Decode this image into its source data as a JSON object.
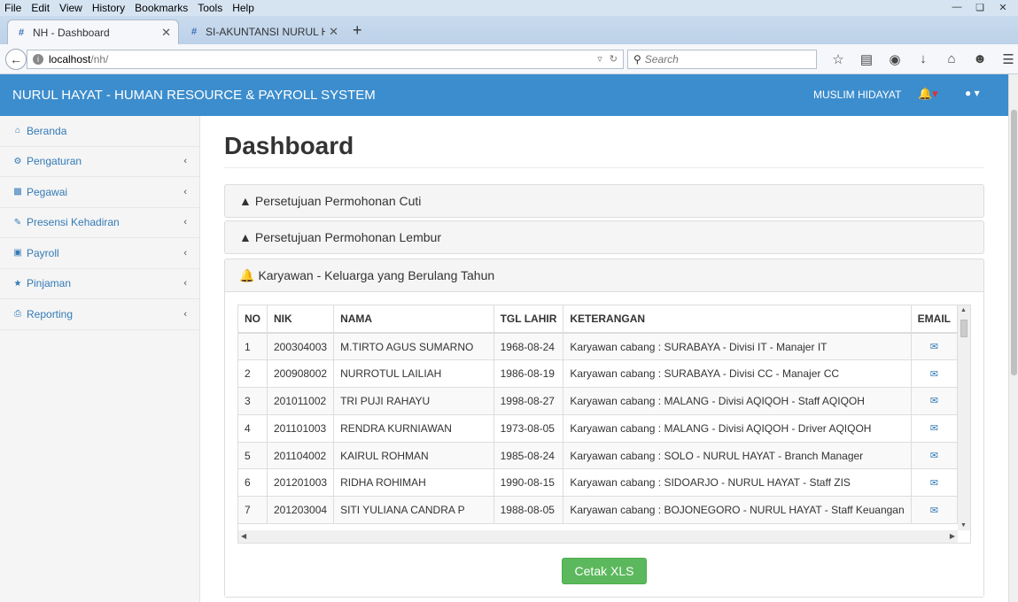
{
  "browser": {
    "menu": [
      "File",
      "Edit",
      "View",
      "History",
      "Bookmarks",
      "Tools",
      "Help"
    ],
    "tabs": [
      {
        "title": "NH - Dashboard",
        "active": true
      },
      {
        "title": "SI-AKUNTANSI NURUL HA...",
        "active": false
      }
    ],
    "url_host": "localhost",
    "url_path": "/nh/",
    "search_placeholder": "Search"
  },
  "header": {
    "brand": "NURUL HAYAT - HUMAN RESOURCE & PAYROLL SYSTEM",
    "user": "MUSLIM HIDAYAT"
  },
  "sidebar": {
    "items": [
      {
        "label": "Beranda",
        "icon": "home-icon"
      },
      {
        "label": "Pengaturan",
        "icon": "cogs-icon"
      },
      {
        "label": "Pegawai",
        "icon": "sitemap-icon"
      },
      {
        "label": "Presensi Kehadiran",
        "icon": "edit-icon"
      },
      {
        "label": "Payroll",
        "icon": "money-icon"
      },
      {
        "label": "Pinjaman",
        "icon": "star-icon"
      },
      {
        "label": "Reporting",
        "icon": "print-icon"
      }
    ]
  },
  "main": {
    "title": "Dashboard",
    "panels": [
      {
        "title": "Persetujuan Permohonan Cuti"
      },
      {
        "title": "Persetujuan Permohonan Lembur"
      },
      {
        "title": "Karyawan - Keluarga yang Berulang Tahun"
      }
    ],
    "table": {
      "columns": [
        "NO",
        "NIK",
        "NAMA",
        "TGL LAHIR",
        "KETERANGAN",
        "EMAIL"
      ],
      "rows": [
        [
          "1",
          "200304003",
          "M.TIRTO AGUS SUMARNO",
          "1968-08-24",
          "Karyawan cabang : SURABAYA - Divisi IT - Manajer IT"
        ],
        [
          "2",
          "200908002",
          "NURROTUL LAILIAH",
          "1986-08-19",
          "Karyawan cabang : SURABAYA - Divisi CC - Manajer CC"
        ],
        [
          "3",
          "201011002",
          "TRI PUJI RAHAYU",
          "1998-08-27",
          "Karyawan cabang : MALANG - Divisi AQIQOH - Staff AQIQOH"
        ],
        [
          "4",
          "201101003",
          "RENDRA KURNIAWAN",
          "1973-08-05",
          "Karyawan cabang : MALANG - Divisi AQIQOH - Driver AQIQOH"
        ],
        [
          "5",
          "201104002",
          "KAIRUL ROHMAN",
          "1985-08-24",
          "Karyawan cabang : SOLO - NURUL HAYAT - Branch Manager"
        ],
        [
          "6",
          "201201003",
          "RIDHA ROHIMAH",
          "1990-08-15",
          "Karyawan cabang : SIDOARJO - NURUL HAYAT - Staff ZIS"
        ],
        [
          "7",
          "201203004",
          "SITI YULIANA CANDRA P",
          "1988-08-05",
          "Karyawan cabang : BOJONEGORO - NURUL HAYAT - Staff Keuangan"
        ]
      ]
    },
    "print_button": "Cetak XLS"
  }
}
